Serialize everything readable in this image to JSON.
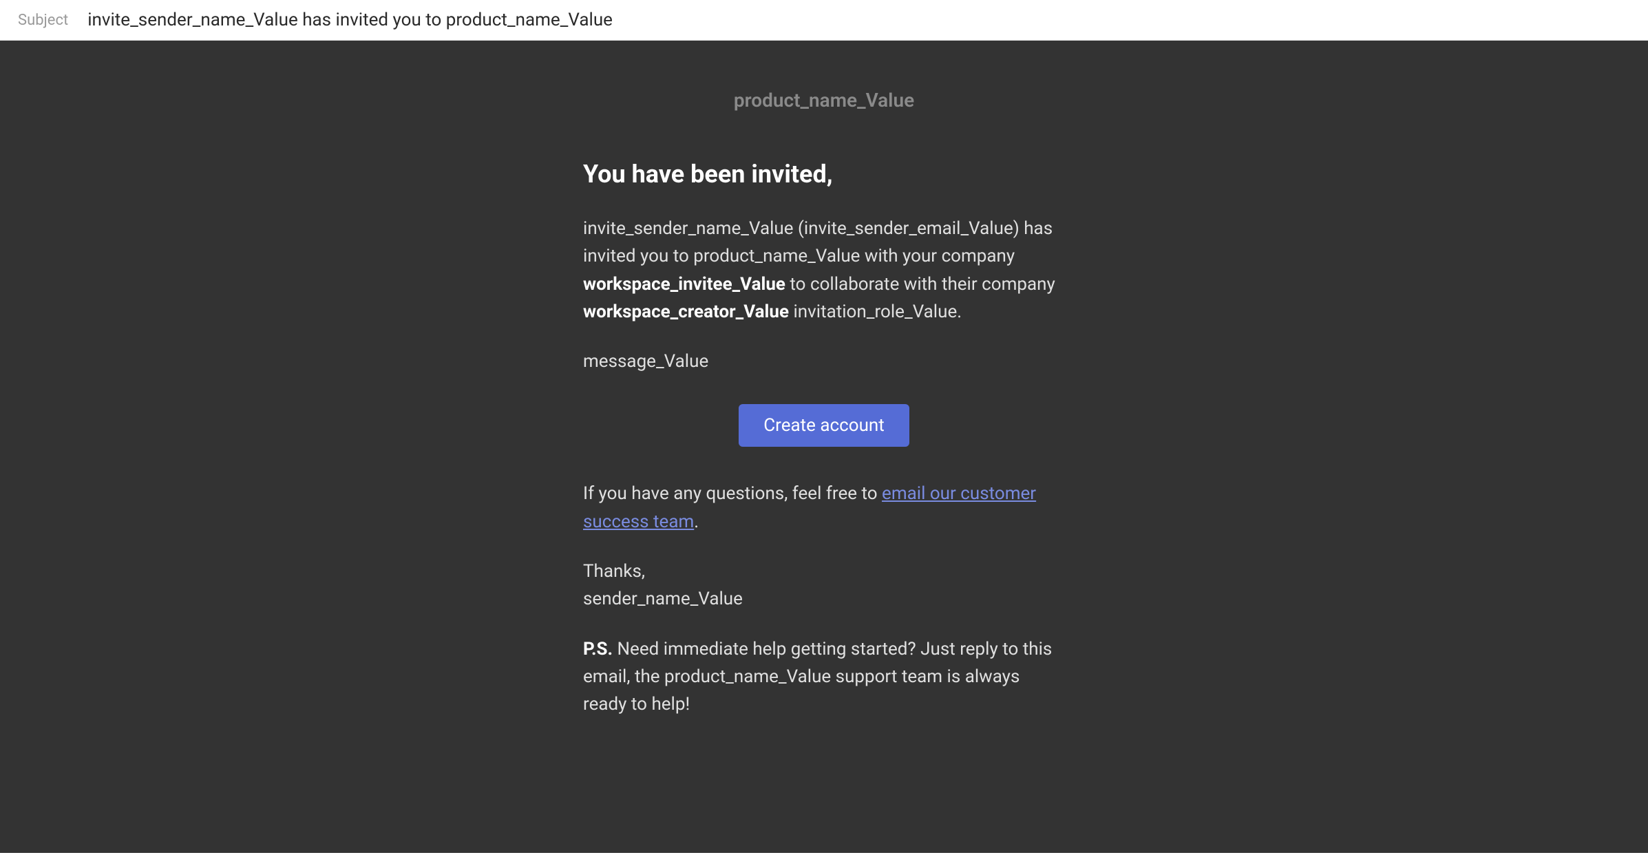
{
  "subject": {
    "label": "Subject",
    "text": "invite_sender_name_Value has invited you to product_name_Value"
  },
  "header": {
    "product_name": "product_name_Value"
  },
  "content": {
    "heading": "You have been invited,",
    "intro_part1": "invite_sender_name_Value (invite_sender_email_Value) has invited you to product_name_Value with your company ",
    "workspace_invitee": "workspace_invitee_Value",
    "intro_part2": " to collaborate with their company ",
    "workspace_creator": "workspace_creator_Value",
    "intro_part3": " invitation_role_Value.",
    "message": "message_Value",
    "cta_label": "Create account",
    "questions_prefix": "If you have any questions, feel free to ",
    "questions_link": "email our customer success team",
    "questions_suffix": ".",
    "thanks": "Thanks,",
    "sender_name": "sender_name_Value",
    "ps_label": "P.S.",
    "ps_text": " Need immediate help getting started? Just reply to this email, the product_name_Value support team is always ready to help!"
  }
}
